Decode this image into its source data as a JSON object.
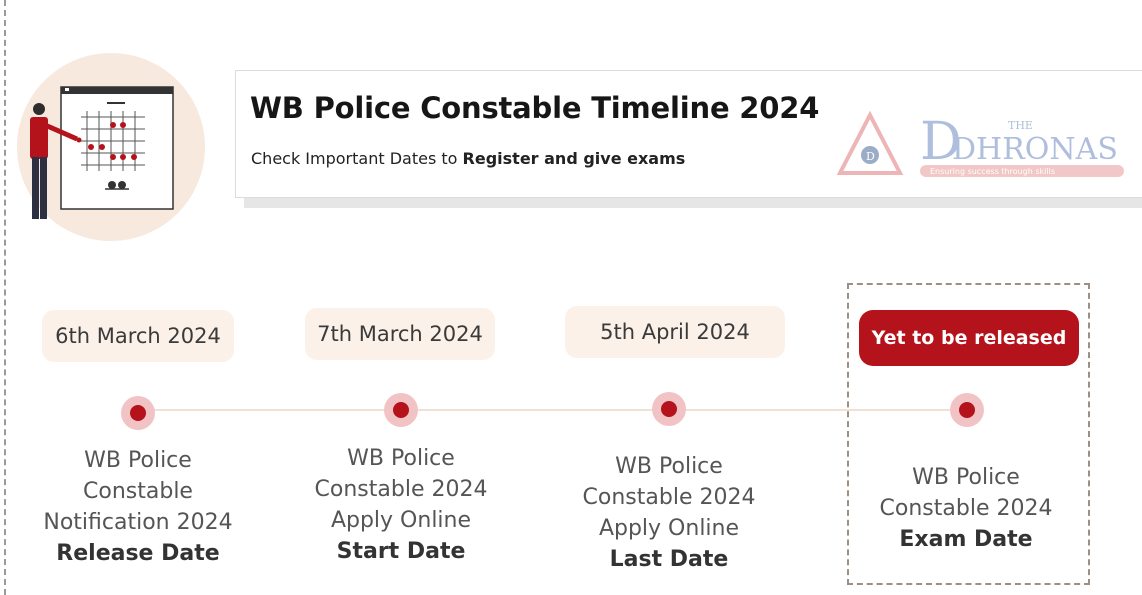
{
  "header": {
    "title": "WB Police Constable Timeline 2024",
    "subtitle_prefix": "Check Important Dates to ",
    "subtitle_bold": "Register and give exams"
  },
  "logo": {
    "the": "THE",
    "name": "DHRONAS",
    "tagline": "Ensuring success through skills"
  },
  "timeline": [
    {
      "date": "6th March 2024",
      "lines": [
        "WB Police",
        "Constable",
        "Notification 2024"
      ],
      "label": "Release Date"
    },
    {
      "date": "7th March 2024",
      "lines": [
        "WB Police",
        "Constable 2024",
        "Apply Online"
      ],
      "label": "Start Date"
    },
    {
      "date": "5th April 2024",
      "lines": [
        "WB Police",
        "Constable 2024",
        "Apply Online"
      ],
      "label": "Last Date"
    },
    {
      "date": "Yet to be released",
      "lines": [
        "WB Police",
        "Constable 2024"
      ],
      "label": "Exam Date"
    }
  ],
  "colors": {
    "accent": "#b5131b",
    "pill_bg": "#fbf1e8",
    "illus_bg": "#f7e9dd"
  }
}
